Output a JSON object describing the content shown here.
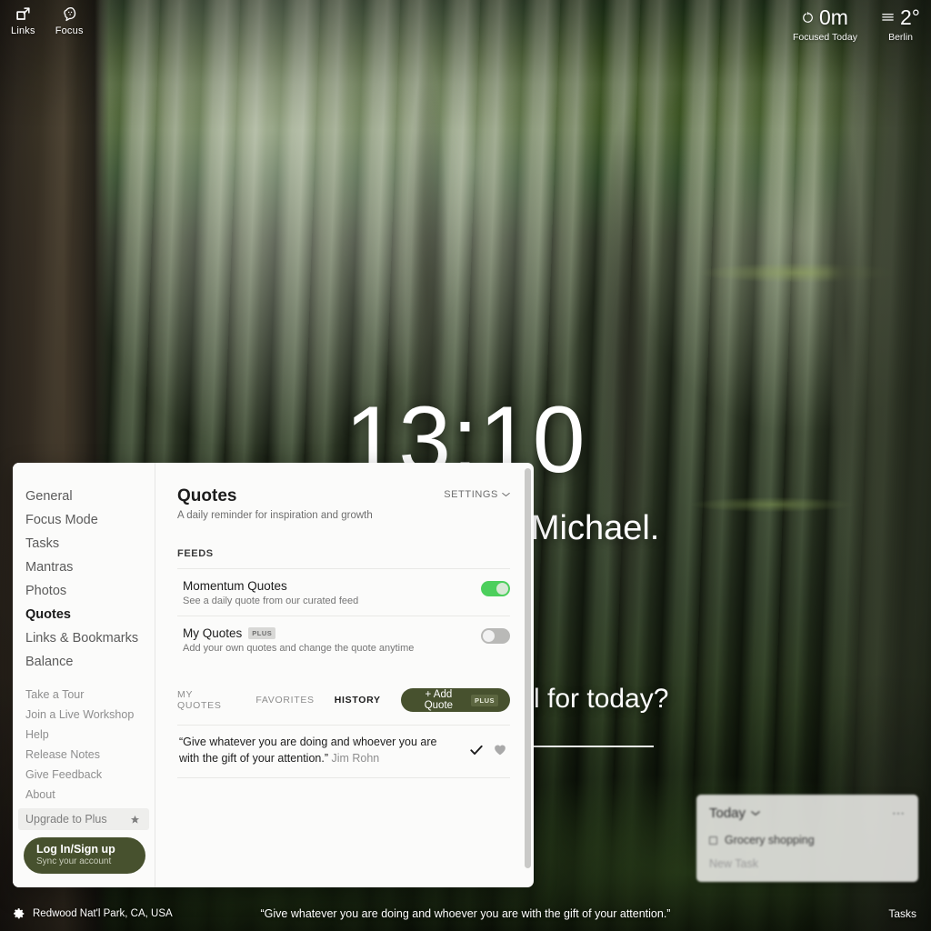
{
  "topbar": {
    "left_items": [
      {
        "label": "Links",
        "icon": "external-link-icon"
      },
      {
        "label": "Focus",
        "icon": "focus-brain-icon"
      }
    ],
    "focus_stat": {
      "value": "0m",
      "caption": "Focused Today",
      "icon": "timer-ring-icon"
    },
    "weather_stat": {
      "value": "2°",
      "caption": "Berlin",
      "icon": "fog-lines-icon"
    }
  },
  "center": {
    "clock": "13:10",
    "greeting": "Good afternoon, Michael.",
    "goal_question": "What is your main goal for today?"
  },
  "bottombar": {
    "location": "Redwood Nat'l Park, CA, USA",
    "location_icon": "gear-icon",
    "quote": "“Give whatever you are doing and whoever you are with the gift of your attention.”",
    "tasks_label": "Tasks"
  },
  "tasks_widget": {
    "title": "Today",
    "chevron_icon": "chevron-down-icon",
    "menu_icon": "ellipsis-icon",
    "items": [
      {
        "label": "Grocery shopping",
        "checked": false
      }
    ],
    "new_task_placeholder": "New Task"
  },
  "settings_panel": {
    "nav": {
      "primary": [
        {
          "label": "General",
          "active": false
        },
        {
          "label": "Focus Mode",
          "active": false
        },
        {
          "label": "Tasks",
          "active": false
        },
        {
          "label": "Mantras",
          "active": false
        },
        {
          "label": "Photos",
          "active": false
        },
        {
          "label": "Quotes",
          "active": true
        },
        {
          "label": "Links & Bookmarks",
          "active": false
        },
        {
          "label": "Balance",
          "active": false
        }
      ],
      "secondary": [
        "Take a Tour",
        "Join a Live Workshop",
        "Help",
        "Release Notes",
        "Give Feedback",
        "About"
      ],
      "upgrade": {
        "label": "Upgrade to Plus",
        "icon": "star-icon"
      },
      "login": {
        "title": "Log In/Sign up",
        "subtitle": "Sync your account"
      }
    },
    "main": {
      "title": "Quotes",
      "subtitle": "A daily reminder for inspiration and growth",
      "settings_link": "SETTINGS",
      "settings_chevron_icon": "chevron-down-icon",
      "section_label": "FEEDS",
      "feeds": [
        {
          "name": "Momentum Quotes",
          "badge": "",
          "description": "See a daily quote from our curated feed",
          "enabled": true
        },
        {
          "name": "My Quotes",
          "badge": "PLUS",
          "description": "Add your own quotes and change the quote anytime",
          "enabled": false
        }
      ],
      "tabs": [
        {
          "label": "MY QUOTES",
          "active": false
        },
        {
          "label": "FAVORITES",
          "active": false
        },
        {
          "label": "HISTORY",
          "active": true
        }
      ],
      "add_button": {
        "label": "+ Add Quote",
        "badge": "PLUS"
      },
      "quotes": [
        {
          "text": "“Give whatever you are doing and whoever you are with the gift of your attention.”",
          "author": "Jim Rohn",
          "check_icon": "check-icon",
          "favorite_icon": "heart-icon"
        }
      ]
    }
  },
  "colors": {
    "accent_green": "#47512e",
    "toggle_on": "#4ccf5c",
    "toggle_off": "#b9b9b7",
    "panel_bg": "#fbfbfa"
  }
}
